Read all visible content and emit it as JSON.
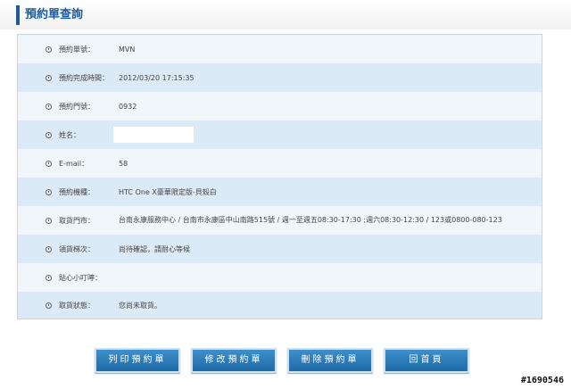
{
  "page": {
    "title": "預約單查詢"
  },
  "fields": [
    {
      "label": "預約單號：",
      "value": "MVN"
    },
    {
      "label": "預約完成時間：",
      "value": "2012/03/20 17:15:35"
    },
    {
      "label": "預約門號：",
      "value": "0932"
    },
    {
      "label": "姓名：",
      "value": ""
    },
    {
      "label": "E-mail：",
      "value": "58"
    },
    {
      "label": "預約機種：",
      "value": "HTC One X豪華限定版-貝殼白"
    },
    {
      "label": "取貨門市：",
      "value": "台南永康服務中心 / 台南市永康區中山南路515號 / 週一至週五08:30-17:30 ;週六08:30-12:30 / 123或0800-080-123"
    },
    {
      "label": "領貨梯次：",
      "value": "尚待確認，請耐心等候"
    },
    {
      "label": "貼心小叮嚀：",
      "value": ""
    },
    {
      "label": "取貨狀態：",
      "value": "您尚未取貨。"
    }
  ],
  "buttons": {
    "print": "列印預約單",
    "edit": "修改預約單",
    "delete": "刪除預約單",
    "home": "回首頁"
  },
  "watermark": "#1690546"
}
